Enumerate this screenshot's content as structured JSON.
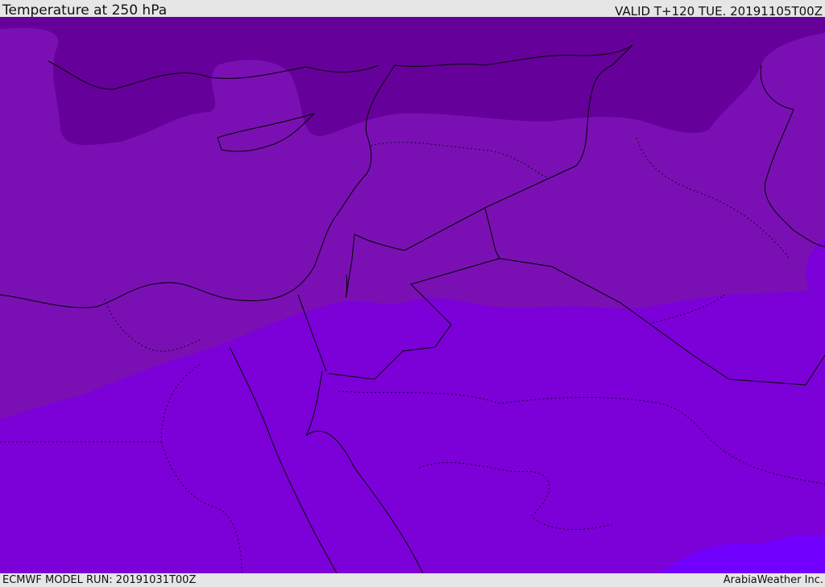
{
  "header": {
    "title": "Temperature at 250 hPa",
    "valid": "VALID T+120 TUE. 20191105T00Z"
  },
  "footer": {
    "model_run": "ECMWF MODEL RUN: 20191031T00Z",
    "credit": "ArabiaWeather Inc."
  },
  "colors": {
    "band_cold": "#66009a",
    "band_mid": "#7a10b4",
    "band_warm": "#7c00d8",
    "band_warmest": "#7200ff",
    "border": "#000000"
  }
}
